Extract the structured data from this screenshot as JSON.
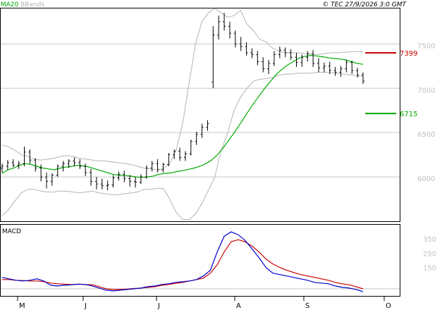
{
  "header": {
    "legend_ma": "MA20",
    "legend_bb": "BBands",
    "copyright": "© TEC 27/9/2026 3:0 GMT"
  },
  "colors": {
    "ma": "#00aa00",
    "bb": "#b4b4b4",
    "bars": "#000000",
    "macd": "#0000cc",
    "signal": "#cc0000",
    "resistance": "#cc0000",
    "support": "#00aa00",
    "grid": "#c8c8c8",
    "panel_bg": "#ffffff",
    "frame": "#000000"
  },
  "chart_data": [
    {
      "type": "line",
      "subtype": "ohlc",
      "title": "",
      "xlabel": "",
      "ylabel": "",
      "ylim": [
        5500,
        7900
      ],
      "yticks": [
        6000,
        6500,
        7000,
        7500
      ],
      "ytick_labels": [
        "6000",
        "6500",
        "7000",
        "7500"
      ],
      "grid": true,
      "x_months": [
        "M",
        "J",
        "J",
        "A",
        "S",
        "O"
      ],
      "levels": [
        {
          "name": "resistance",
          "value": 7399,
          "label": "7399"
        },
        {
          "name": "support",
          "value": 6715,
          "label": "6715"
        }
      ],
      "series": [
        {
          "name": "MA20",
          "values": [
            6040,
            6080,
            6100,
            6130,
            6150,
            6140,
            6120,
            6100,
            6090,
            6080,
            6100,
            6110,
            6120,
            6130,
            6125,
            6110,
            6090,
            6070,
            6050,
            6030,
            6020,
            6015,
            6010,
            6000,
            5995,
            6000,
            6010,
            6030,
            6040,
            6045,
            6060,
            6070,
            6085,
            6100,
            6120,
            6150,
            6190,
            6250,
            6330,
            6420,
            6510,
            6610,
            6710,
            6810,
            6900,
            6990,
            7070,
            7150,
            7210,
            7260,
            7300,
            7340,
            7360,
            7370,
            7365,
            7355,
            7345,
            7335,
            7330,
            7320,
            7300,
            7280,
            7270
          ]
        },
        {
          "name": "BBands",
          "values": [
            6360,
            6340,
            6300,
            6250,
            6230,
            6200,
            6190,
            6200,
            6210,
            6230,
            6240,
            6230,
            6210,
            6200,
            6190,
            6180,
            6180,
            6170,
            6160,
            6150,
            6140,
            6120,
            6100,
            6090,
            6080,
            6090,
            6150,
            6300,
            6600,
            7050,
            7500,
            7750,
            7850,
            7900,
            7850,
            7800,
            7820,
            7880,
            7720,
            7650,
            7550,
            7520,
            7450,
            7420,
            7400,
            7400,
            7400,
            7390,
            7380,
            7380,
            7390,
            7400,
            7400,
            7405,
            7410,
            7415,
            7410
          ]
        },
        {
          "name": "BBands",
          "values": [
            5560,
            5630,
            5730,
            5820,
            5860,
            5860,
            5840,
            5830,
            5830,
            5840,
            5840,
            5830,
            5820,
            5830,
            5840,
            5820,
            5810,
            5800,
            5800,
            5810,
            5820,
            5830,
            5860,
            5860,
            5870,
            5870,
            5750,
            5600,
            5520,
            5520,
            5580,
            5700,
            5850,
            6000,
            6300,
            6500,
            6750,
            6900,
            7000,
            7080,
            7100,
            7110,
            7120,
            7150,
            7160,
            7160,
            7170,
            7170,
            7170,
            7180,
            7180,
            7175,
            7170,
            7160,
            7150,
            7140,
            7135
          ]
        }
      ],
      "ohlc": [
        [
          6100,
          6150,
          6050,
          6120
        ],
        [
          6120,
          6190,
          6080,
          6160
        ],
        [
          6160,
          6200,
          6110,
          6130
        ],
        [
          6130,
          6180,
          6090,
          6150
        ],
        [
          6150,
          6340,
          6120,
          6280
        ],
        [
          6280,
          6310,
          6150,
          6190
        ],
        [
          6190,
          6210,
          6060,
          6100
        ],
        [
          6100,
          6140,
          5950,
          6000
        ],
        [
          6000,
          6050,
          5870,
          5950
        ],
        [
          5950,
          6040,
          5900,
          6020
        ],
        [
          6020,
          6140,
          6000,
          6120
        ],
        [
          6120,
          6180,
          6060,
          6150
        ],
        [
          6150,
          6200,
          6100,
          6180
        ],
        [
          6180,
          6220,
          6120,
          6160
        ],
        [
          6160,
          6200,
          6090,
          6120
        ],
        [
          6120,
          6150,
          6010,
          6050
        ],
        [
          6050,
          6090,
          5900,
          5950
        ],
        [
          5950,
          6000,
          5860,
          5920
        ],
        [
          5920,
          5980,
          5860,
          5900
        ],
        [
          5900,
          5960,
          5850,
          5910
        ],
        [
          5910,
          6020,
          5880,
          5990
        ],
        [
          5990,
          6060,
          5960,
          6030
        ],
        [
          6030,
          6070,
          5940,
          5980
        ],
        [
          5980,
          6020,
          5890,
          5950
        ],
        [
          5950,
          6000,
          5880,
          5940
        ],
        [
          5940,
          6030,
          5920,
          6000
        ],
        [
          6000,
          6130,
          5980,
          6100
        ],
        [
          6100,
          6180,
          6060,
          6150
        ],
        [
          6150,
          6200,
          6050,
          6080
        ],
        [
          6080,
          6160,
          6050,
          6140
        ],
        [
          6140,
          6270,
          6120,
          6250
        ],
        [
          6250,
          6310,
          6200,
          6290
        ],
        [
          6290,
          6330,
          6180,
          6220
        ],
        [
          6220,
          6290,
          6180,
          6260
        ],
        [
          6260,
          6420,
          6240,
          6400
        ],
        [
          6400,
          6510,
          6360,
          6480
        ],
        [
          6480,
          6600,
          6440,
          6560
        ],
        [
          6560,
          6640,
          6520,
          6600
        ],
        [
          7070,
          7700,
          7000,
          7600
        ],
        [
          7600,
          7820,
          7550,
          7750
        ],
        [
          7750,
          7850,
          7650,
          7700
        ],
        [
          7700,
          7750,
          7560,
          7620
        ],
        [
          7620,
          7650,
          7460,
          7500
        ],
        [
          7500,
          7580,
          7420,
          7470
        ],
        [
          7470,
          7520,
          7370,
          7400
        ],
        [
          7400,
          7450,
          7340,
          7380
        ],
        [
          7380,
          7420,
          7260,
          7300
        ],
        [
          7300,
          7350,
          7180,
          7220
        ],
        [
          7220,
          7320,
          7160,
          7280
        ],
        [
          7280,
          7420,
          7250,
          7380
        ],
        [
          7380,
          7470,
          7340,
          7430
        ],
        [
          7430,
          7460,
          7350,
          7400
        ],
        [
          7400,
          7440,
          7320,
          7350
        ],
        [
          7350,
          7400,
          7240,
          7290
        ],
        [
          7290,
          7380,
          7240,
          7350
        ],
        [
          7350,
          7420,
          7300,
          7390
        ],
        [
          7390,
          7430,
          7240,
          7280
        ],
        [
          7280,
          7340,
          7180,
          7230
        ],
        [
          7230,
          7290,
          7180,
          7250
        ],
        [
          7250,
          7300,
          7160,
          7200
        ],
        [
          7200,
          7240,
          7140,
          7180
        ],
        [
          7180,
          7250,
          7130,
          7220
        ],
        [
          7220,
          7320,
          7180,
          7290
        ],
        [
          7290,
          7310,
          7160,
          7200
        ],
        [
          7200,
          7230,
          7120,
          7150
        ],
        [
          7150,
          7180,
          7050,
          7080
        ]
      ]
    },
    {
      "type": "line",
      "title": "MACD",
      "xlabel": "",
      "ylabel": "",
      "ylim": [
        -50,
        450
      ],
      "yticks": [
        150,
        250,
        350
      ],
      "ytick_labels": [
        "150",
        "250",
        "350"
      ],
      "grid": true,
      "series": [
        {
          "name": "MACD",
          "values": [
            80,
            70,
            60,
            55,
            60,
            70,
            55,
            25,
            20,
            25,
            28,
            32,
            30,
            20,
            5,
            -10,
            -15,
            -10,
            -5,
            0,
            5,
            15,
            20,
            30,
            35,
            45,
            50,
            55,
            65,
            90,
            130,
            260,
            370,
            400,
            380,
            340,
            280,
            220,
            150,
            110,
            100,
            90,
            80,
            70,
            60,
            45,
            40,
            35,
            20,
            10,
            5,
            -5,
            -20
          ]
        },
        {
          "name": "Signal",
          "values": [
            65,
            65,
            60,
            58,
            55,
            55,
            50,
            40,
            35,
            32,
            30,
            32,
            30,
            28,
            15,
            0,
            -5,
            -5,
            -2,
            2,
            5,
            10,
            15,
            25,
            30,
            38,
            45,
            55,
            65,
            75,
            110,
            170,
            260,
            330,
            345,
            330,
            300,
            260,
            210,
            175,
            150,
            130,
            115,
            100,
            90,
            80,
            70,
            60,
            45,
            35,
            28,
            15,
            0
          ]
        }
      ]
    }
  ]
}
